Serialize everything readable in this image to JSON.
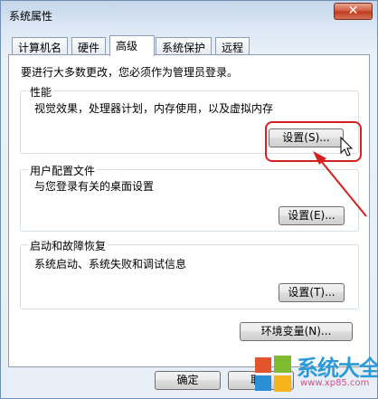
{
  "window": {
    "title": "系统属性",
    "close_glyph": "✕"
  },
  "tabs": [
    {
      "label": "计算机名"
    },
    {
      "label": "硬件"
    },
    {
      "label": "高级",
      "active": true
    },
    {
      "label": "系统保护"
    },
    {
      "label": "远程"
    }
  ],
  "advanced": {
    "admin_note": "要进行大多数更改，您必须作为管理员登录。",
    "performance": {
      "title": "性能",
      "desc": "视觉效果，处理器计划，内存使用，以及虚拟内存",
      "button": "设置(S)..."
    },
    "user_profiles": {
      "title": "用户配置文件",
      "desc": "与您登录有关的桌面设置",
      "button": "设置(E)..."
    },
    "startup_recovery": {
      "title": "启动和故障恢复",
      "desc": "系统启动、系统失败和调试信息",
      "button": "设置(T)..."
    },
    "env_button": "环境变量(N)..."
  },
  "footer": {
    "ok_label": "确定",
    "cancel_label": "取"
  },
  "watermark": {
    "brand": "系统大全",
    "url": "www.xp85.com"
  },
  "colors": {
    "annotation_red": "#d32020",
    "titlebar": "#c5d6ea",
    "close_button": "#c8432a"
  },
  "icons": {
    "close": "close-icon",
    "cursor": "mouse-pointer-icon",
    "logo": "windows-logo-icon"
  }
}
